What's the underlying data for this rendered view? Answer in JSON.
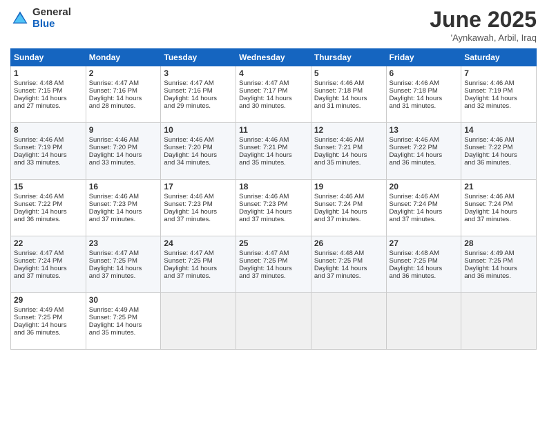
{
  "header": {
    "logo_general": "General",
    "logo_blue": "Blue",
    "month_title": "June 2025",
    "location": "'Aynkawah, Arbil, Iraq"
  },
  "days_of_week": [
    "Sunday",
    "Monday",
    "Tuesday",
    "Wednesday",
    "Thursday",
    "Friday",
    "Saturday"
  ],
  "weeks": [
    [
      {
        "day": 1,
        "lines": [
          "Sunrise: 4:48 AM",
          "Sunset: 7:15 PM",
          "Daylight: 14 hours",
          "and 27 minutes."
        ]
      },
      {
        "day": 2,
        "lines": [
          "Sunrise: 4:47 AM",
          "Sunset: 7:16 PM",
          "Daylight: 14 hours",
          "and 28 minutes."
        ]
      },
      {
        "day": 3,
        "lines": [
          "Sunrise: 4:47 AM",
          "Sunset: 7:16 PM",
          "Daylight: 14 hours",
          "and 29 minutes."
        ]
      },
      {
        "day": 4,
        "lines": [
          "Sunrise: 4:47 AM",
          "Sunset: 7:17 PM",
          "Daylight: 14 hours",
          "and 30 minutes."
        ]
      },
      {
        "day": 5,
        "lines": [
          "Sunrise: 4:46 AM",
          "Sunset: 7:18 PM",
          "Daylight: 14 hours",
          "and 31 minutes."
        ]
      },
      {
        "day": 6,
        "lines": [
          "Sunrise: 4:46 AM",
          "Sunset: 7:18 PM",
          "Daylight: 14 hours",
          "and 31 minutes."
        ]
      },
      {
        "day": 7,
        "lines": [
          "Sunrise: 4:46 AM",
          "Sunset: 7:19 PM",
          "Daylight: 14 hours",
          "and 32 minutes."
        ]
      }
    ],
    [
      {
        "day": 8,
        "lines": [
          "Sunrise: 4:46 AM",
          "Sunset: 7:19 PM",
          "Daylight: 14 hours",
          "and 33 minutes."
        ]
      },
      {
        "day": 9,
        "lines": [
          "Sunrise: 4:46 AM",
          "Sunset: 7:20 PM",
          "Daylight: 14 hours",
          "and 33 minutes."
        ]
      },
      {
        "day": 10,
        "lines": [
          "Sunrise: 4:46 AM",
          "Sunset: 7:20 PM",
          "Daylight: 14 hours",
          "and 34 minutes."
        ]
      },
      {
        "day": 11,
        "lines": [
          "Sunrise: 4:46 AM",
          "Sunset: 7:21 PM",
          "Daylight: 14 hours",
          "and 35 minutes."
        ]
      },
      {
        "day": 12,
        "lines": [
          "Sunrise: 4:46 AM",
          "Sunset: 7:21 PM",
          "Daylight: 14 hours",
          "and 35 minutes."
        ]
      },
      {
        "day": 13,
        "lines": [
          "Sunrise: 4:46 AM",
          "Sunset: 7:22 PM",
          "Daylight: 14 hours",
          "and 36 minutes."
        ]
      },
      {
        "day": 14,
        "lines": [
          "Sunrise: 4:46 AM",
          "Sunset: 7:22 PM",
          "Daylight: 14 hours",
          "and 36 minutes."
        ]
      }
    ],
    [
      {
        "day": 15,
        "lines": [
          "Sunrise: 4:46 AM",
          "Sunset: 7:22 PM",
          "Daylight: 14 hours",
          "and 36 minutes."
        ]
      },
      {
        "day": 16,
        "lines": [
          "Sunrise: 4:46 AM",
          "Sunset: 7:23 PM",
          "Daylight: 14 hours",
          "and 37 minutes."
        ]
      },
      {
        "day": 17,
        "lines": [
          "Sunrise: 4:46 AM",
          "Sunset: 7:23 PM",
          "Daylight: 14 hours",
          "and 37 minutes."
        ]
      },
      {
        "day": 18,
        "lines": [
          "Sunrise: 4:46 AM",
          "Sunset: 7:23 PM",
          "Daylight: 14 hours",
          "and 37 minutes."
        ]
      },
      {
        "day": 19,
        "lines": [
          "Sunrise: 4:46 AM",
          "Sunset: 7:24 PM",
          "Daylight: 14 hours",
          "and 37 minutes."
        ]
      },
      {
        "day": 20,
        "lines": [
          "Sunrise: 4:46 AM",
          "Sunset: 7:24 PM",
          "Daylight: 14 hours",
          "and 37 minutes."
        ]
      },
      {
        "day": 21,
        "lines": [
          "Sunrise: 4:46 AM",
          "Sunset: 7:24 PM",
          "Daylight: 14 hours",
          "and 37 minutes."
        ]
      }
    ],
    [
      {
        "day": 22,
        "lines": [
          "Sunrise: 4:47 AM",
          "Sunset: 7:24 PM",
          "Daylight: 14 hours",
          "and 37 minutes."
        ]
      },
      {
        "day": 23,
        "lines": [
          "Sunrise: 4:47 AM",
          "Sunset: 7:25 PM",
          "Daylight: 14 hours",
          "and 37 minutes."
        ]
      },
      {
        "day": 24,
        "lines": [
          "Sunrise: 4:47 AM",
          "Sunset: 7:25 PM",
          "Daylight: 14 hours",
          "and 37 minutes."
        ]
      },
      {
        "day": 25,
        "lines": [
          "Sunrise: 4:47 AM",
          "Sunset: 7:25 PM",
          "Daylight: 14 hours",
          "and 37 minutes."
        ]
      },
      {
        "day": 26,
        "lines": [
          "Sunrise: 4:48 AM",
          "Sunset: 7:25 PM",
          "Daylight: 14 hours",
          "and 37 minutes."
        ]
      },
      {
        "day": 27,
        "lines": [
          "Sunrise: 4:48 AM",
          "Sunset: 7:25 PM",
          "Daylight: 14 hours",
          "and 36 minutes."
        ]
      },
      {
        "day": 28,
        "lines": [
          "Sunrise: 4:49 AM",
          "Sunset: 7:25 PM",
          "Daylight: 14 hours",
          "and 36 minutes."
        ]
      }
    ],
    [
      {
        "day": 29,
        "lines": [
          "Sunrise: 4:49 AM",
          "Sunset: 7:25 PM",
          "Daylight: 14 hours",
          "and 36 minutes."
        ]
      },
      {
        "day": 30,
        "lines": [
          "Sunrise: 4:49 AM",
          "Sunset: 7:25 PM",
          "Daylight: 14 hours",
          "and 35 minutes."
        ]
      },
      null,
      null,
      null,
      null,
      null
    ]
  ]
}
